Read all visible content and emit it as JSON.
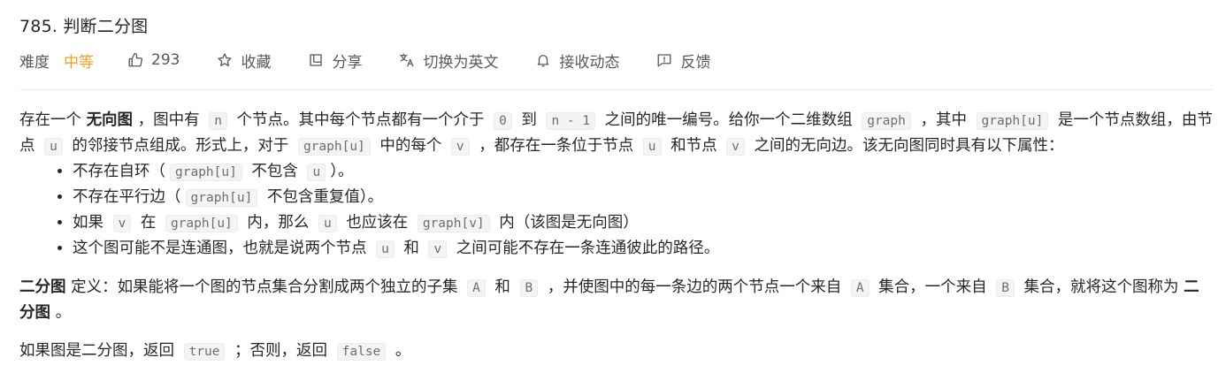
{
  "problem": {
    "title": "785. 判断二分图"
  },
  "meta": {
    "difficulty_label": "难度",
    "difficulty_value": "中等",
    "likes": "293",
    "favorite_label": "收藏",
    "share_label": "分享",
    "switch_lang_label": "切换为英文",
    "subscribe_label": "接收动态",
    "feedback_label": "反馈",
    "difficulty_color": "#f0a020"
  },
  "icons": [
    "thumbs-up-icon",
    "star-icon",
    "share-icon",
    "translate-icon",
    "bell-icon",
    "feedback-icon"
  ],
  "desc": {
    "p1": {
      "t1": "存在一个 ",
      "b1": "无向图",
      "t2": " ，图中有 ",
      "c1": "n",
      "t3": " 个节点。其中每个节点都有一个介于 ",
      "c2": "0",
      "t4": " 到 ",
      "c3": "n - 1",
      "t5": " 之间的唯一编号。给你一个二维数组 ",
      "c4": "graph",
      "t6": " ，其中 ",
      "c5": "graph[u]",
      "t7": " 是一个节点数组，由节点 ",
      "c6": "u",
      "t8": " 的邻接节点组成。形式上，对于 ",
      "c7": "graph[u]",
      "t9": " 中的每个 ",
      "c8": "v",
      "t10": " ，都存在一条位于节点 ",
      "c9": "u",
      "t11": " 和节点 ",
      "c10": "v",
      "t12": " 之间的无向边。该无向图同时具有以下属性："
    },
    "list": [
      {
        "t1": "不存在自环（",
        "c1": "graph[u]",
        "t2": " 不包含 ",
        "c2": "u",
        "t3": "）。"
      },
      {
        "t1": "不存在平行边（",
        "c1": "graph[u]",
        "t2": " 不包含重复值）。"
      },
      {
        "t1": "如果 ",
        "c1": "v",
        "t2": " 在 ",
        "c2": "graph[u]",
        "t3": " 内，那么 ",
        "c3": "u",
        "t4": " 也应该在 ",
        "c4": "graph[v]",
        "t5": " 内（该图是无向图）"
      },
      {
        "t1": "这个图可能不是连通图，也就是说两个节点 ",
        "c1": "u",
        "t2": " 和 ",
        "c2": "v",
        "t3": " 之间可能不存在一条连通彼此的路径。"
      }
    ],
    "p2": {
      "b1": "二分图",
      "t1": " 定义：如果能将一个图的节点集合分割成两个独立的子集 ",
      "c1": "A",
      "t2": " 和 ",
      "c2": "B",
      "t3": " ，并使图中的每一条边的两个节点一个来自 ",
      "c3": "A",
      "t4": " 集合，一个来自 ",
      "c4": "B",
      "t5": " 集合，就将这个图称为 ",
      "b2": "二分图",
      "t6": " 。"
    },
    "p3": {
      "t1": "如果图是二分图，返回 ",
      "c1": "true",
      "t2": " ；否则，返回 ",
      "c2": "false",
      "t3": " 。"
    }
  }
}
